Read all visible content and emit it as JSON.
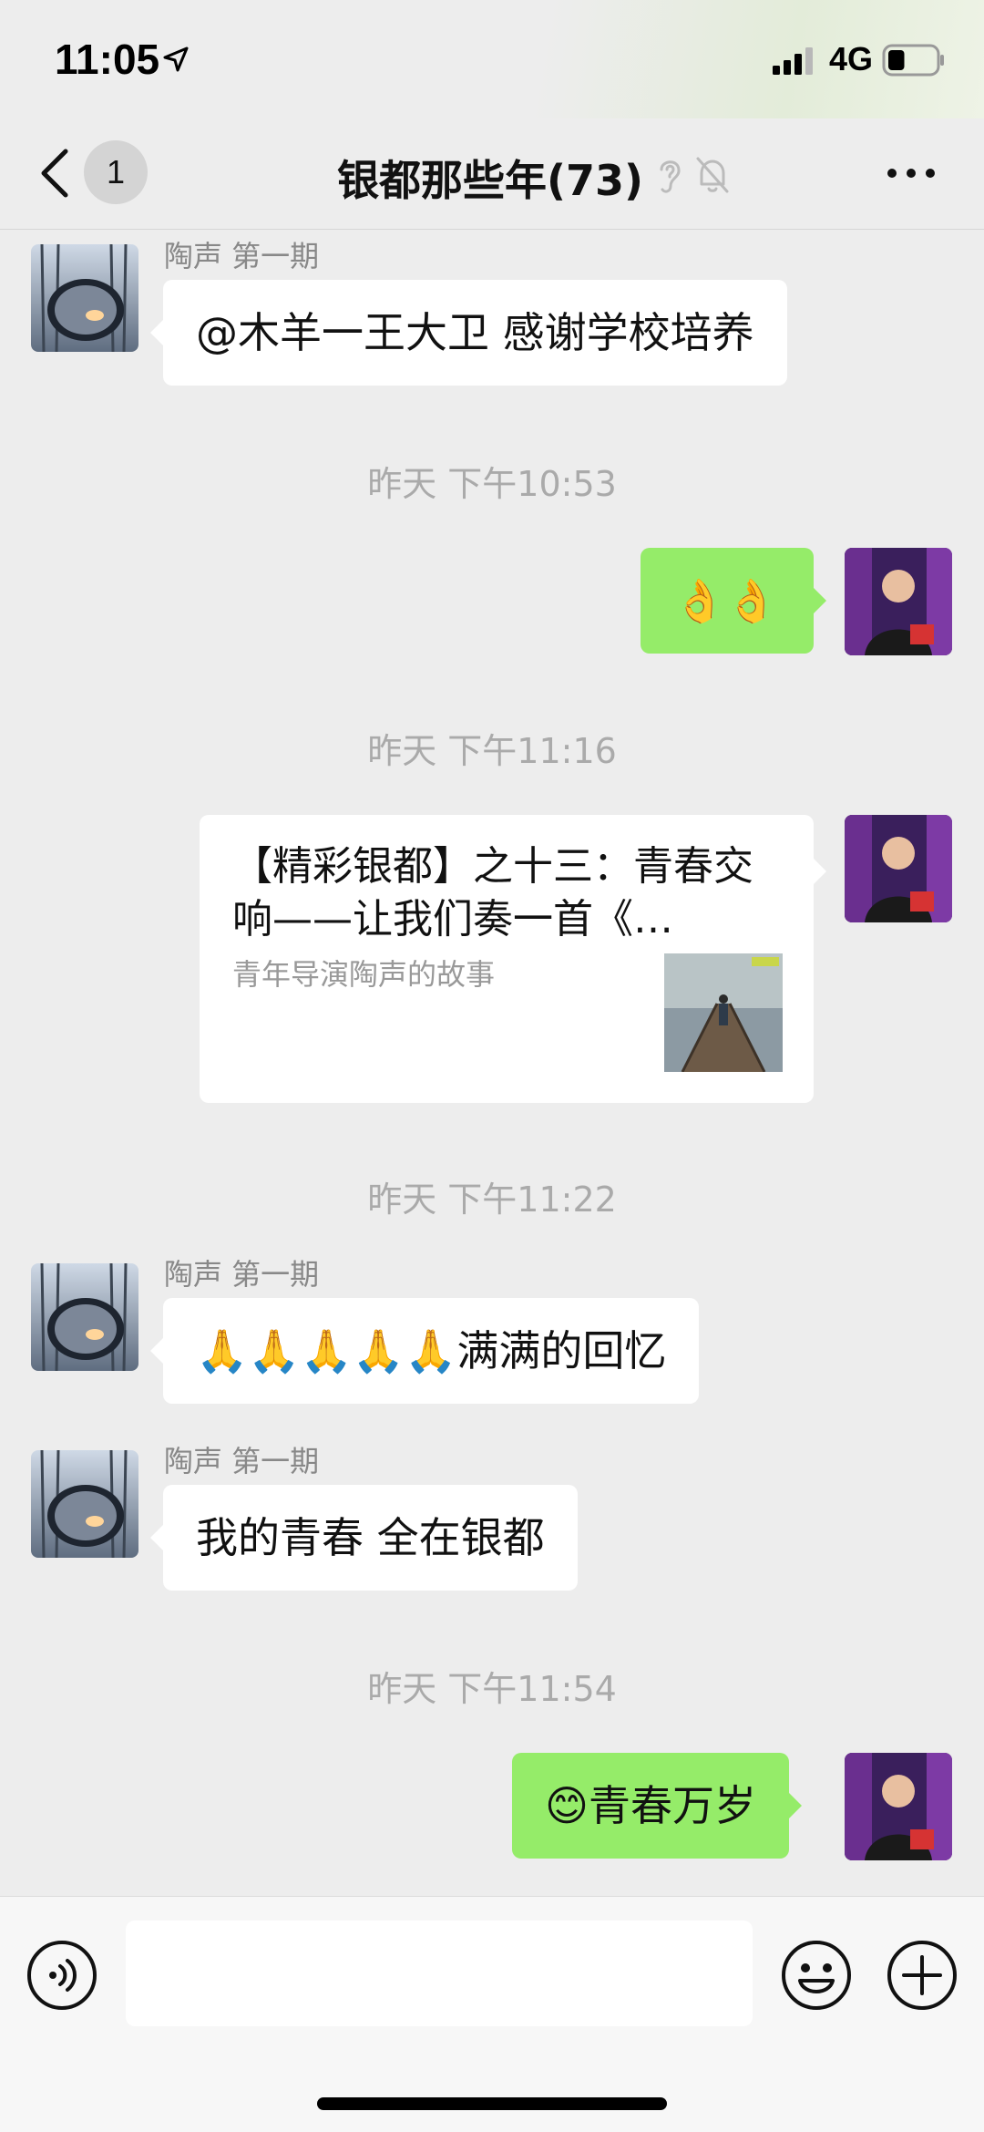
{
  "status_bar": {
    "time": "11:05",
    "network": "4G",
    "battery_level": 0.35
  },
  "nav": {
    "back_badge": "1",
    "title": "银都那些年(73)"
  },
  "messages": [
    {
      "sender": "陶声 第一期",
      "text": "@木羊一王大卫 感谢学校培养"
    },
    {
      "timestamp": "昨天 下午10:53"
    },
    {
      "text": "👌👌"
    },
    {
      "timestamp": "昨天 下午11:16"
    },
    {
      "link_title": "【精彩银都】之十三：青春交响——让我们奏一首《…",
      "link_desc": "青年导演陶声的故事"
    },
    {
      "timestamp": "昨天 下午11:22"
    },
    {
      "sender": "陶声 第一期",
      "text": "🙏🙏🙏🙏🙏满满的回忆"
    },
    {
      "sender": "陶声 第一期",
      "text": "我的青春 全在银都"
    },
    {
      "timestamp": "昨天 下午11:54"
    },
    {
      "text": "😊青春万岁"
    }
  ],
  "colors": {
    "green_bubble": "#95ec69",
    "background": "#ededed"
  },
  "icons": [
    "location-arrow-icon",
    "signal-icon",
    "battery-icon",
    "back-chevron-icon",
    "ear-icon",
    "mute-bell-icon",
    "more-icon",
    "voice-icon",
    "emoji-icon",
    "plus-icon"
  ]
}
